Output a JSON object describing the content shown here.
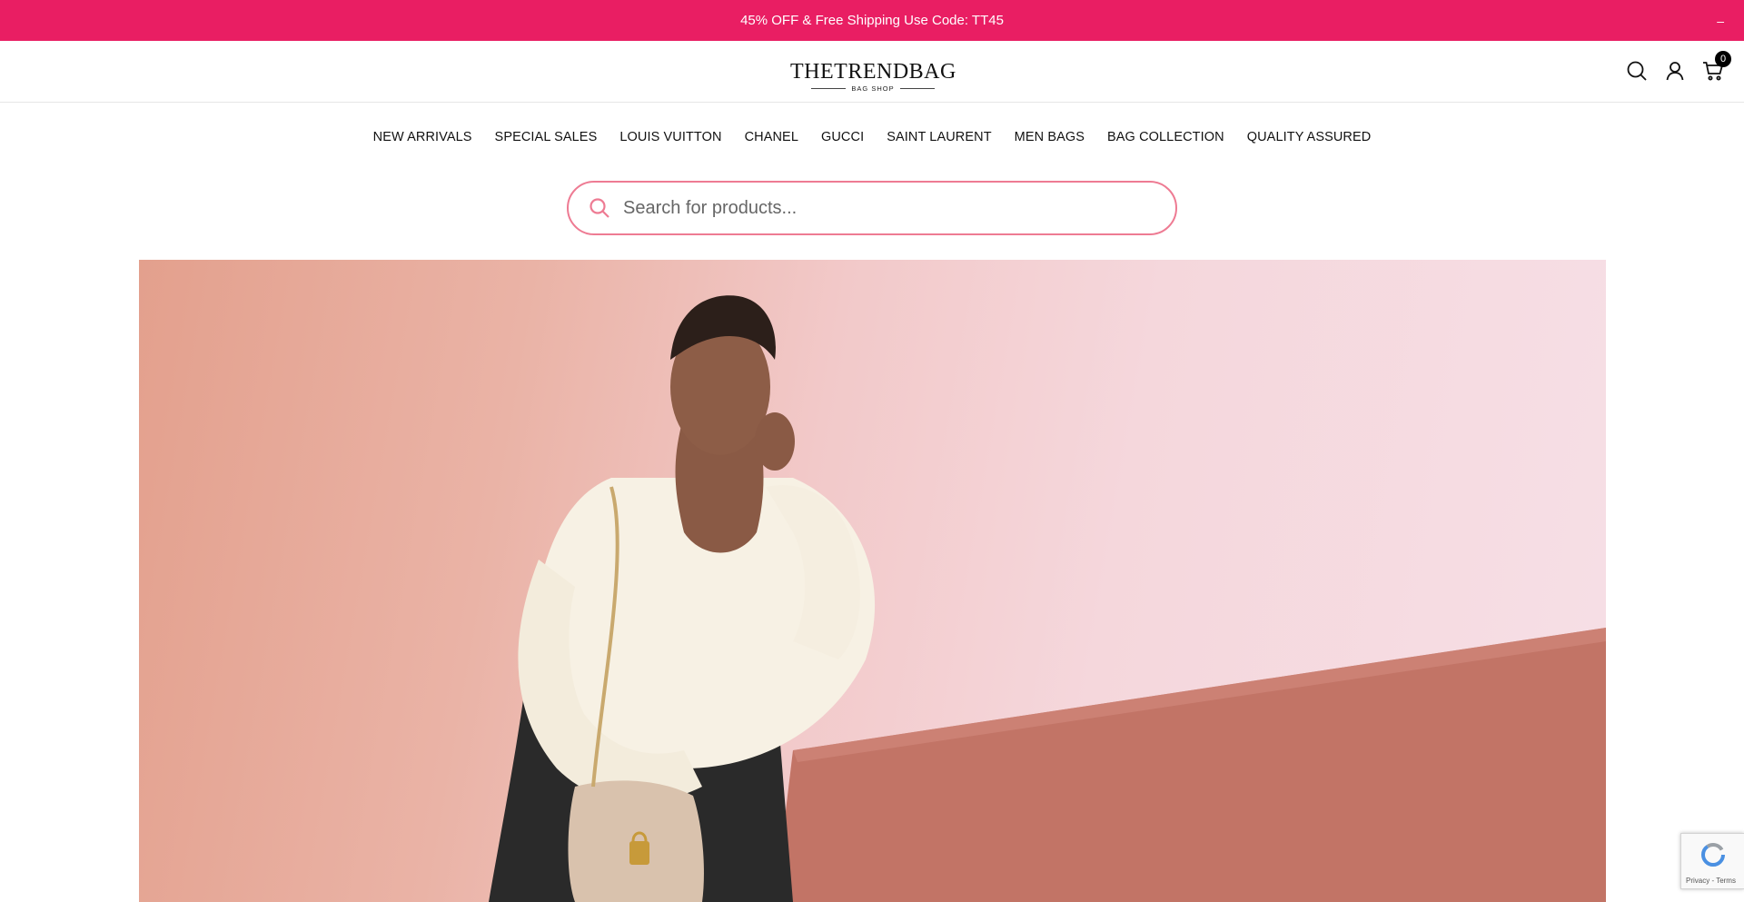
{
  "announcement": {
    "text": "45% OFF & Free Shipping Use Code: TT45",
    "close_label": "–",
    "background": "#e91e63"
  },
  "header": {
    "logo_main": "THETRENDBAG",
    "logo_sub": "BAG SHOP",
    "icons": [
      "search-icon",
      "account-icon",
      "cart-icon"
    ],
    "cart_count": "0"
  },
  "nav": {
    "items": [
      {
        "label": "NEW ARRIVALS"
      },
      {
        "label": "SPECIAL SALES"
      },
      {
        "label": "LOUIS VUITTON"
      },
      {
        "label": "CHANEL"
      },
      {
        "label": "GUCCI"
      },
      {
        "label": "SAINT LAURENT"
      },
      {
        "label": "MEN BAGS"
      },
      {
        "label": "BAG COLLECTION"
      },
      {
        "label": "QUALITY ASSURED"
      }
    ]
  },
  "search": {
    "placeholder": "Search for products...",
    "value": "",
    "accent": "#ee7b93"
  },
  "hero": {
    "image": "model-with-handbag-photo"
  },
  "recaptcha": {
    "text": "Privacy - Terms"
  }
}
